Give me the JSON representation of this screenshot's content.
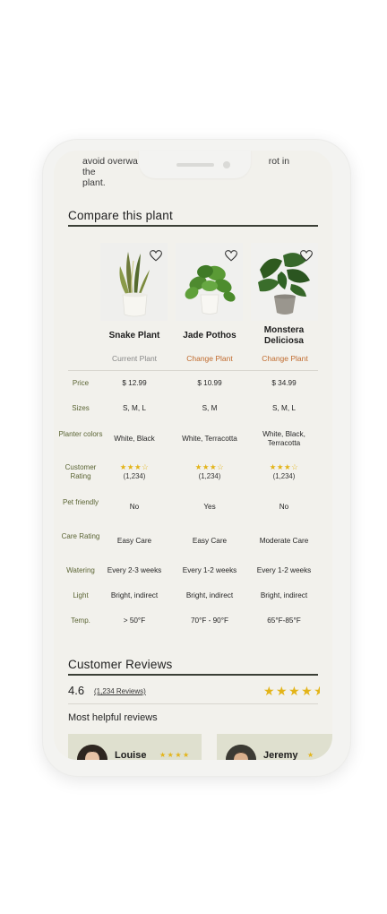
{
  "intro": {
    "line1_left": "avoid overwa",
    "line1_right": "rot in the",
    "line2": "plant."
  },
  "compare": {
    "title": "Compare this plant",
    "plants": [
      {
        "name": "Snake Plant",
        "link": "Current Plant"
      },
      {
        "name": "Jade Pothos",
        "link": "Change Plant"
      },
      {
        "name": "Monstera Deliciosa",
        "link": "Change Plant"
      }
    ],
    "rows": [
      {
        "label": "Price",
        "values": [
          "$ 12.99",
          "$ 10.99",
          "$ 34.99"
        ]
      },
      {
        "label": "Sizes",
        "values": [
          "S, M, L",
          "S, M",
          "S, M, L"
        ]
      },
      {
        "label": "Planter colors",
        "values": [
          "White, Black",
          "White, Terracotta",
          "White, Black, Terracotta"
        ]
      },
      {
        "label": "Customer Rating",
        "stars": [
          "★★★☆",
          "★★★☆",
          "★★★☆"
        ],
        "counts": [
          "(1,234)",
          "(1,234)",
          "(1,234)"
        ]
      },
      {
        "label": "Pet friendly",
        "values": [
          "No",
          "Yes",
          "No"
        ]
      },
      {
        "label": "Care Rating",
        "values": [
          "Easy Care",
          "Easy Care",
          "Moderate Care"
        ]
      },
      {
        "label": "Watering",
        "values": [
          "Every 2-3 weeks",
          "Every 1-2 weeks",
          "Every 1-2 weeks"
        ]
      },
      {
        "label": "Light",
        "values": [
          "Bright, indirect",
          "Bright, indirect",
          "Bright, indirect"
        ]
      },
      {
        "label": "Temp.",
        "values": [
          ">  50°F",
          "70°F - 90°F",
          "65°F-85°F"
        ]
      }
    ]
  },
  "reviews": {
    "title": "Customer Reviews",
    "rating": "4.6",
    "count_link": "(1,234 Reviews)",
    "stars": "★★★★",
    "rating_value": 4.6,
    "helpful_title": "Most helpful reviews",
    "cards": [
      {
        "name": "Louise",
        "stars": "★★★★"
      },
      {
        "name": "Jeremy",
        "stars": "★"
      }
    ]
  },
  "colors": {
    "accent": "#5a6433",
    "link": "#c06a2d",
    "star": "#e3b418",
    "screen_bg": "#f2f1ec",
    "card_bg": "#dfe0cf"
  }
}
